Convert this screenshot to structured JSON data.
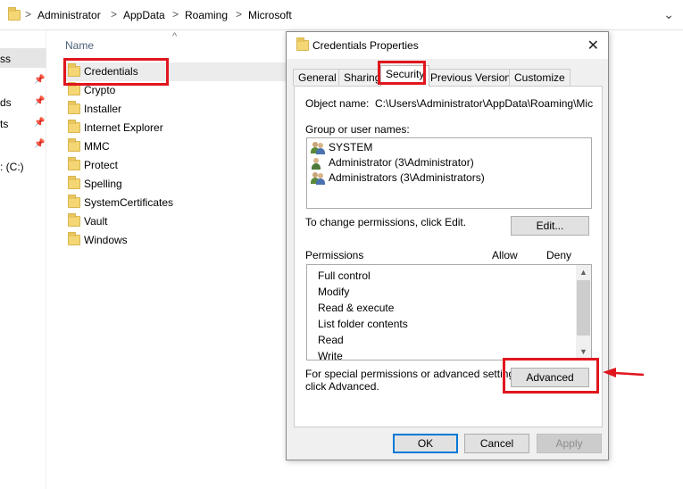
{
  "address_bar": {
    "crumbs": [
      "Administrator",
      "AppData",
      "Roaming",
      "Microsoft"
    ],
    "separator": ">",
    "dropdown_glyph": "⌄"
  },
  "nav_pane": {
    "items": [
      "ss",
      "ds",
      "ts",
      ": (C:)"
    ],
    "pin_glyph": "📌"
  },
  "file_list": {
    "column_header": "Name",
    "sort_glyph": "^",
    "folders": [
      "Credentials",
      "Crypto",
      "Installer",
      "Internet Explorer",
      "MMC",
      "Protect",
      "Spelling",
      "SystemCertificates",
      "Vault",
      "Windows"
    ],
    "selected": "Credentials"
  },
  "dialog": {
    "title": "Credentials Properties",
    "close_glyph": "✕",
    "tabs": [
      "General",
      "Sharing",
      "Security",
      "Previous Versions",
      "Customize"
    ],
    "active_tab": "Security",
    "object_name_label": "Object name:",
    "object_name_value": "C:\\Users\\Administrator\\AppData\\Roaming\\Microsc",
    "group_label": "Group or user names:",
    "users": [
      "SYSTEM",
      "Administrator (3\\Administrator)",
      "Administrators (3\\Administrators)"
    ],
    "change_text": "To change permissions, click Edit.",
    "edit_button": "Edit...",
    "permissions_label": "Permissions",
    "allow_label": "Allow",
    "deny_label": "Deny",
    "permissions": [
      "Full control",
      "Modify",
      "Read & execute",
      "List folder contents",
      "Read",
      "Write"
    ],
    "special_text_line1": "For special permissions or advanced settings,",
    "special_text_line2": "click Advanced.",
    "advanced_button": "Advanced",
    "ok_button": "OK",
    "cancel_button": "Cancel",
    "apply_button": "Apply",
    "scroll_up_glyph": "▲",
    "scroll_down_glyph": "▼"
  },
  "colors": {
    "highlight": "#e0161e",
    "folder": "#f4d675",
    "selection": "#ececec"
  }
}
